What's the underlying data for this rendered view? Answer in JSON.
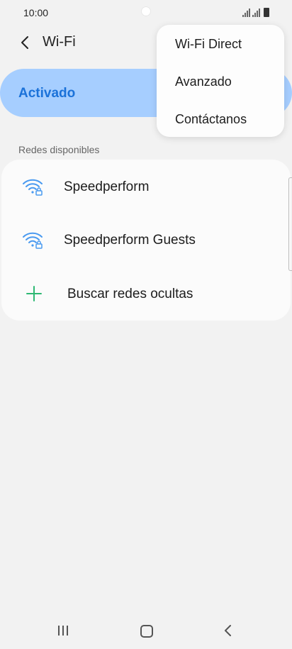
{
  "status_bar": {
    "time": "10:00"
  },
  "header": {
    "title": "Wi-Fi"
  },
  "toggle": {
    "label": "Activado",
    "color": "#a6ceff",
    "label_color": "#1b72d9"
  },
  "section": {
    "available_networks_label": "Redes disponibles"
  },
  "networks": [
    {
      "name": "Speedperform",
      "icon": "wifi-lock-icon"
    },
    {
      "name": "Speedperform Guests",
      "icon": "wifi-lock-icon"
    }
  ],
  "add_network": {
    "label": "Buscar redes ocultas",
    "icon": "plus-icon",
    "icon_color": "#2eb873"
  },
  "overflow_menu": {
    "items": [
      "Wi-Fi Direct",
      "Avanzado",
      "Contáctanos"
    ]
  },
  "nav_bar": {
    "recents_icon": "recents-icon",
    "home_icon": "home-icon",
    "back_icon": "back-icon"
  }
}
